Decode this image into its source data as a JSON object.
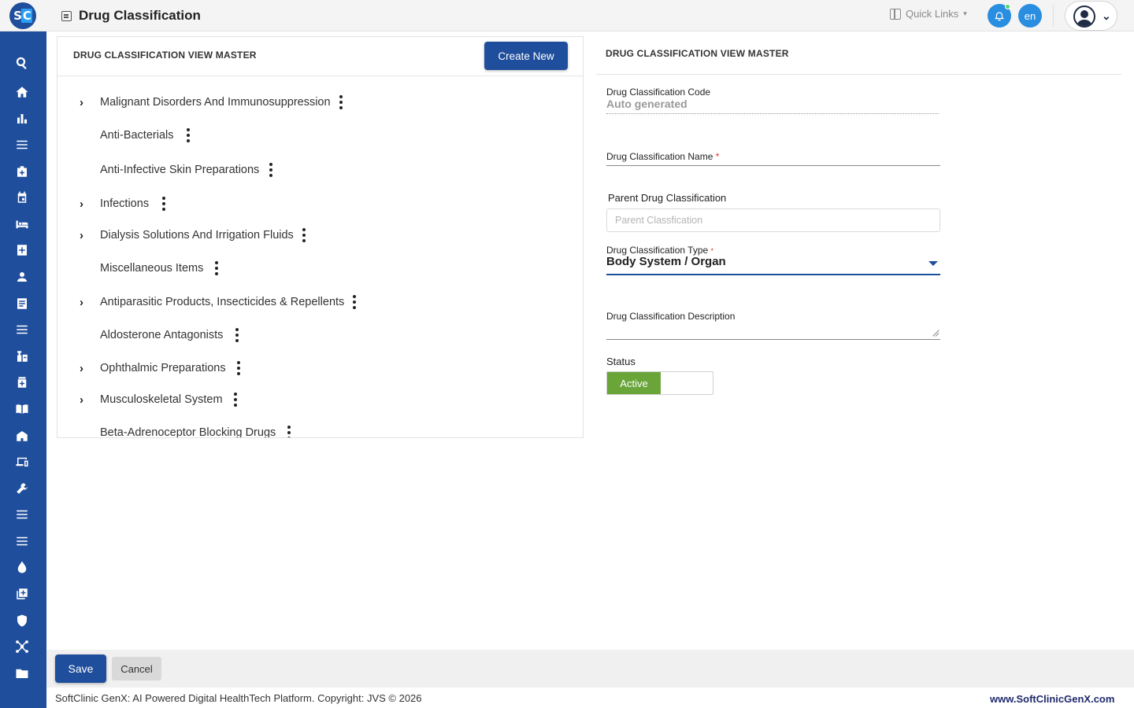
{
  "header": {
    "page_title": "Drug Classification",
    "quick_links_label": "Quick Links",
    "language": "en"
  },
  "sidebar": {
    "icons": [
      "search-icon",
      "home-icon",
      "bar-chart-icon",
      "menu-icon",
      "medical-bag-icon",
      "calendar-icon",
      "bed-icon",
      "medical-plus-icon",
      "person-icon",
      "document-list-icon",
      "menu-icon",
      "pharmacy-icon",
      "medicine-icon",
      "book-icon",
      "building-icon",
      "devices-icon",
      "wrench-icon",
      "menu-icon",
      "menu-icon",
      "drop-icon",
      "add-box-icon",
      "shield-icon",
      "network-icon",
      "folder-icon"
    ]
  },
  "tree_panel": {
    "title": "DRUG CLASSIFICATION VIEW MASTER",
    "create_button": "Create New",
    "items": [
      {
        "label": "Malignant Disorders And Immunosuppression",
        "expandable": true
      },
      {
        "label": "Anti-Bacterials",
        "expandable": false
      },
      {
        "label": "Anti-Infective Skin Preparations",
        "expandable": false
      },
      {
        "label": "Infections",
        "expandable": true
      },
      {
        "label": "Dialysis Solutions And Irrigation Fluids",
        "expandable": true
      },
      {
        "label": "Miscellaneous Items",
        "expandable": false
      },
      {
        "label": "Antiparasitic Products, Insecticides & Repellents",
        "expandable": true
      },
      {
        "label": "Aldosterone Antagonists",
        "expandable": false
      },
      {
        "label": "Ophthalmic Preparations",
        "expandable": true
      },
      {
        "label": "Musculoskeletal System",
        "expandable": true
      },
      {
        "label": "Beta-Adrenoceptor Blocking Drugs",
        "expandable": false
      }
    ]
  },
  "form": {
    "title": "DRUG CLASSIFICATION VIEW MASTER",
    "code_label": "Drug Classification Code",
    "code_value": "Auto generated",
    "name_label": "Drug Classification Name",
    "required_mark": "*",
    "parent_label": "Parent Drug Classification",
    "parent_placeholder": "Parent Classfication",
    "type_label": "Drug Classification Type",
    "type_value": "Body System / Organ",
    "description_label": "Drug Classification Description",
    "status_label": "Status",
    "status_value": "Active"
  },
  "actions": {
    "save": "Save",
    "cancel": "Cancel"
  },
  "footer": {
    "copyright": "SoftClinic GenX: AI Powered Digital HealthTech Platform. Copyright: JVS © 2026",
    "website": "www.SoftClinicGenX.com"
  },
  "colors": {
    "brand": "#1f4e9c",
    "accent": "#2a8ee0",
    "active_green": "#6aa53a"
  }
}
